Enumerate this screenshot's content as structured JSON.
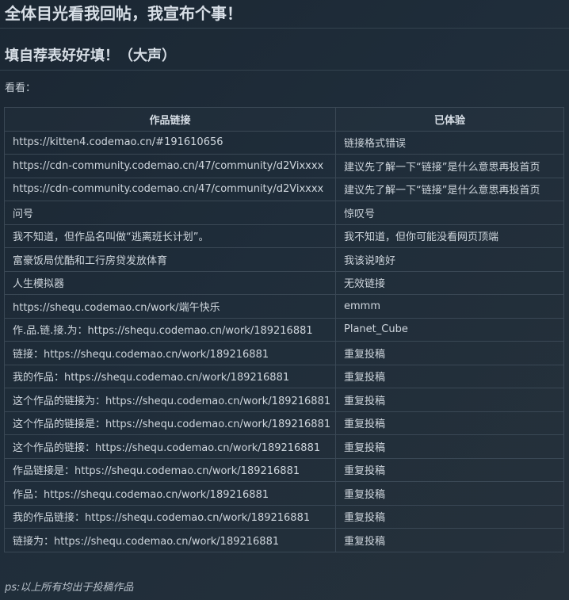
{
  "post": {
    "heading": "全体目光看我回帖，我宣布个事！",
    "subheading": "填自荐表好好填！（大声）",
    "intro": "看看：",
    "table": {
      "columns": [
        "作品链接",
        "已体验"
      ],
      "rows": [
        [
          "https://kitten4.codemao.cn/#191610656",
          "链接格式错误"
        ],
        [
          "https://cdn-community.codemao.cn/47/community/d2Vixxxx",
          "建议先了解一下“链接”是什么意思再投首页"
        ],
        [
          "https://cdn-community.codemao.cn/47/community/d2Vixxxx",
          "建议先了解一下“链接”是什么意思再投首页"
        ],
        [
          "问号",
          "惊叹号"
        ],
        [
          "我不知道，但作品名叫做“逃离班长计划”。",
          "我不知道，但你可能没看网页顶端"
        ],
        [
          "富豪饭局优酷和工行房贷发放体育",
          "我该说啥好"
        ],
        [
          "人生模拟器",
          "无效链接"
        ],
        [
          "https://shequ.codemao.cn/work/端午快乐",
          "emmm"
        ],
        [
          "作.品.链.接.为：https://shequ.codemao.cn/work/189216881",
          "Planet_Cube"
        ],
        [
          "链接：https://shequ.codemao.cn/work/189216881",
          "重复投稿"
        ],
        [
          "我的作品：https://shequ.codemao.cn/work/189216881",
          "重复投稿"
        ],
        [
          "这个作品的链接为：https://shequ.codemao.cn/work/189216881",
          "重复投稿"
        ],
        [
          "这个作品的链接是：https://shequ.codemao.cn/work/189216881",
          "重复投稿"
        ],
        [
          "这个作品的链接：https://shequ.codemao.cn/work/189216881",
          "重复投稿"
        ],
        [
          "作品链接是：https://shequ.codemao.cn/work/189216881",
          "重复投稿"
        ],
        [
          "作品：https://shequ.codemao.cn/work/189216881",
          "重复投稿"
        ],
        [
          "我的作品链接：https://shequ.codemao.cn/work/189216881",
          "重复投稿"
        ],
        [
          "链接为：https://shequ.codemao.cn/work/189216881",
          "重复投稿"
        ]
      ]
    },
    "footnote": "ps:以上所有均出于投稿作品"
  },
  "colors": {
    "background": "#1f2d3a",
    "text": "#c9d1d9",
    "border": "#3a4855"
  }
}
